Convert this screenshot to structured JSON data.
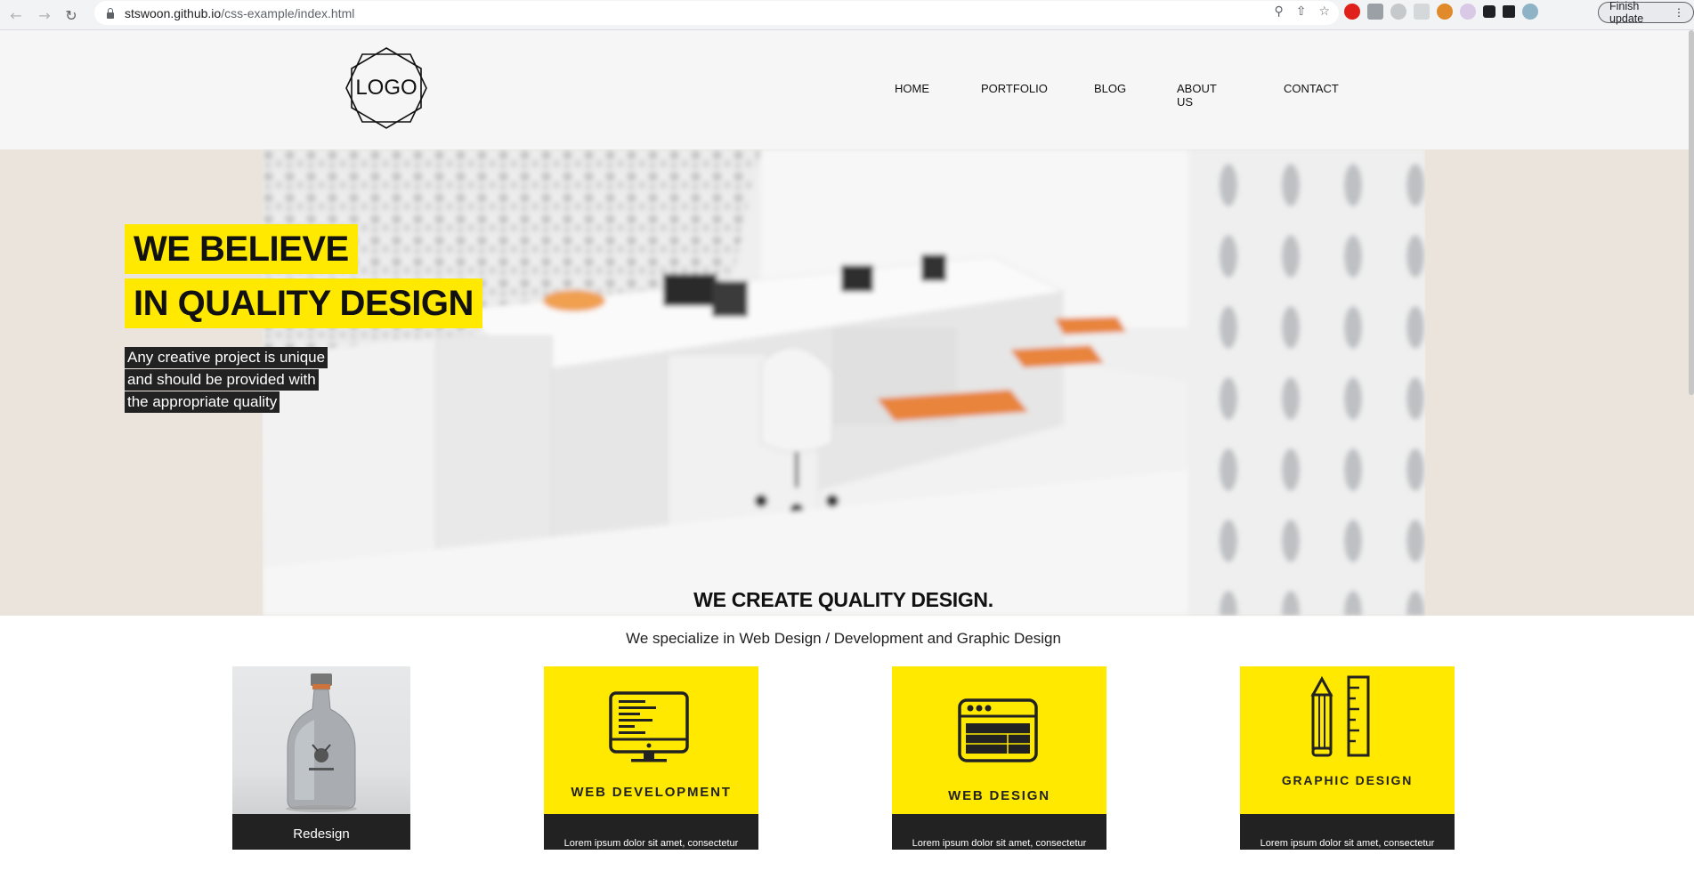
{
  "browser": {
    "url_host": "stswoon.github.io",
    "url_path": "/css-example/index.html",
    "finish_update_label": "Finish update"
  },
  "header": {
    "logo_text": "LOGO",
    "menu": [
      "HOME",
      "PORTFOLIO",
      "BLOG",
      "ABOUT US",
      "CONTACT"
    ]
  },
  "hero": {
    "headline_1": "WE BELIEVE",
    "headline_2": "IN QUALITY DESIGN",
    "sub_1": "Any creative project is unique",
    "sub_2": "and should be provided with",
    "sub_3": "the appropriate quality"
  },
  "section": {
    "title": "WE CREATE QUALITY DESIGN.",
    "subtitle": "We specialize in Web Design / Development and Graphic Design"
  },
  "cards": [
    {
      "footer": "Redesign"
    },
    {
      "label": "WEB DEVELOPMENT",
      "footer": "Lorem ipsum dolor sit amet, consectetur"
    },
    {
      "label": "WEB DESIGN",
      "footer": "Lorem ipsum dolor sit amet, consectetur"
    },
    {
      "label": "GRAPHIC DESIGN",
      "footer": "Lorem ipsum dolor sit amet, consectetur"
    }
  ],
  "colors": {
    "accent_yellow": "#ffe900",
    "dark": "#222222",
    "hero_bg": "#eae4dc"
  }
}
